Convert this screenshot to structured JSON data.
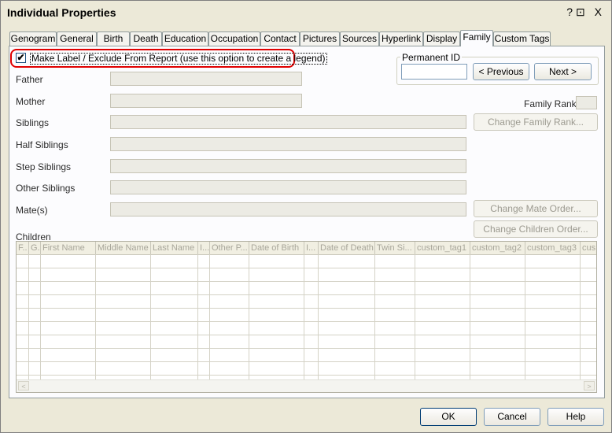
{
  "window": {
    "title": "Individual Properties",
    "title_icons": "?⊡ X"
  },
  "tabs": [
    {
      "label": "Genogram"
    },
    {
      "label": "General"
    },
    {
      "label": "Birth"
    },
    {
      "label": "Death"
    },
    {
      "label": "Education"
    },
    {
      "label": "Occupation"
    },
    {
      "label": "Contact"
    },
    {
      "label": "Pictures"
    },
    {
      "label": "Sources"
    },
    {
      "label": "Hyperlink"
    },
    {
      "label": "Display"
    },
    {
      "label": "Family"
    },
    {
      "label": "Custom Tags"
    }
  ],
  "active_tab": "Family",
  "make_label": {
    "checked": true,
    "check_glyph": "✔",
    "label": "Make Label / Exclude From Report (use this option to create a legend)"
  },
  "permanent_id": {
    "title": "Permanent ID",
    "value": "",
    "previous_label": "< Previous",
    "next_label": "Next >"
  },
  "fields": {
    "father": "Father",
    "mother": "Mother",
    "siblings": "Siblings",
    "half_siblings": "Half Siblings",
    "step_siblings": "Step Siblings",
    "other_siblings": "Other Siblings",
    "mates": "Mate(s)",
    "children": "Children"
  },
  "family_rank": {
    "label": "Family Rank",
    "value": ""
  },
  "buttons": {
    "change_family_rank": "Change Family Rank...",
    "change_mate_order": "Change Mate Order...",
    "change_children_order": "Change Children Order...",
    "ok": "OK",
    "cancel": "Cancel",
    "help": "Help"
  },
  "children_columns": [
    "F..",
    "G.",
    "First Name",
    "Middle Name",
    "Last Name",
    "I...",
    "Other P...",
    "Date of Birth",
    "I...",
    "Date of Death",
    "Twin Si...",
    "custom_tag1",
    "custom_tag2",
    "custom_tag3",
    "cus"
  ],
  "scroll_icons": {
    "left": "<",
    "right": ">"
  }
}
